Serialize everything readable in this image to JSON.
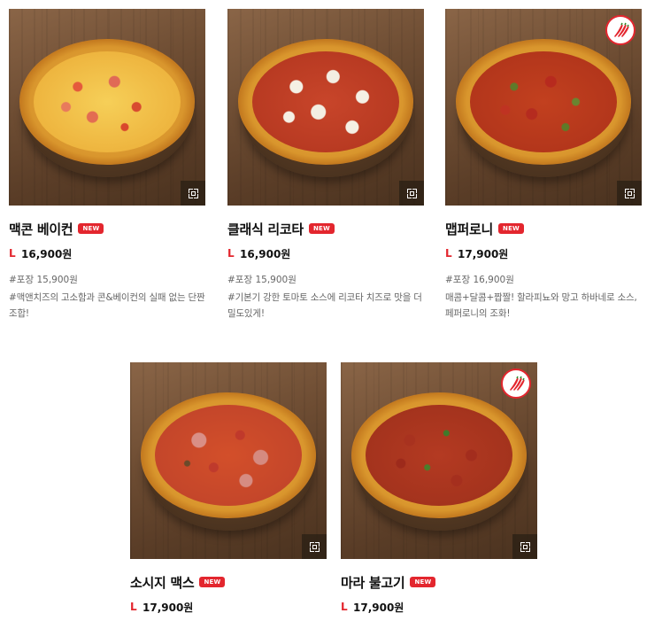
{
  "products": [
    {
      "name": "맥콘 베이컨",
      "badge": "NEW",
      "size": "L",
      "price": "16,900원",
      "pack_price": "#포장 15,900원",
      "description": "#맥앤치즈의 고소함과 콘&베이컨의 실패 없는 단짠 조합!",
      "spicy": false,
      "zoom_icon": "zoom-icon"
    },
    {
      "name": "클래식 리코타",
      "badge": "NEW",
      "size": "L",
      "price": "16,900원",
      "pack_price": "#포장 15,900원",
      "description": "#기본기 강한 토마토 소스에 리코타 치즈로 맛을 더 밀도있게!",
      "spicy": false,
      "zoom_icon": "zoom-icon"
    },
    {
      "name": "맵퍼로니",
      "badge": "NEW",
      "size": "L",
      "price": "17,900원",
      "pack_price": "#포장 16,900원",
      "description": "매콤+달콤+짭짤! 할라피뇨와 망고 하바네로 소스, 페퍼로니의 조화!",
      "spicy": true,
      "zoom_icon": "zoom-icon"
    },
    {
      "name": "소시지 맥스",
      "badge": "NEW",
      "size": "L",
      "price": "17,900원",
      "spicy": false,
      "zoom_icon": "zoom-icon"
    },
    {
      "name": "마라 불고기",
      "badge": "NEW",
      "size": "L",
      "price": "17,900원",
      "spicy": true,
      "zoom_icon": "zoom-icon"
    }
  ],
  "colors": {
    "accent_red": "#e3262e",
    "text": "#111111",
    "muted": "#666666"
  }
}
